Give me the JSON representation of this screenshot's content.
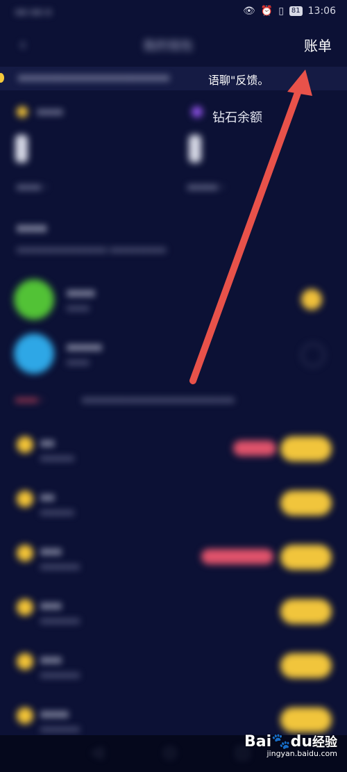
{
  "status_bar": {
    "carrier": "",
    "time": "13:06",
    "battery": "81"
  },
  "header": {
    "title": "我的钱包",
    "bill_button": "账单",
    "back_icon": "chevron-left-icon"
  },
  "notice": {
    "text_visible": "语聊\"反馈。"
  },
  "balances": {
    "diamond_label": "钻石余额"
  },
  "colors": {
    "background": "#0c1135",
    "coin_gold": "#f3c437",
    "arrow_red": "#e8524a",
    "price_pill": "#f1c53c",
    "tag_pink": "#e0536b"
  },
  "watermark": {
    "brand": "Bai",
    "brand_mid": "du",
    "brand_suffix": "经验",
    "url": "jingyan.baidu.com"
  }
}
